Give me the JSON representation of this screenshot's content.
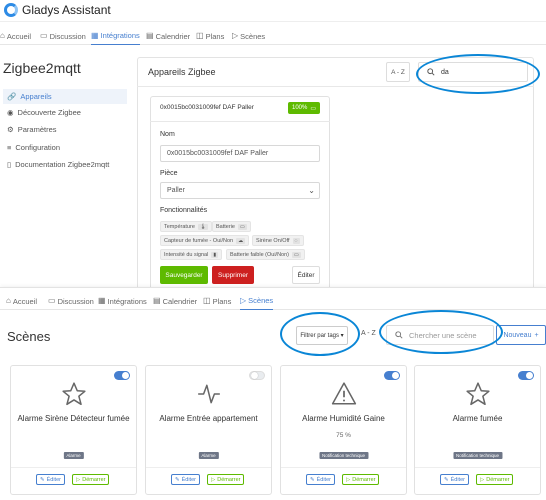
{
  "app": {
    "title": "Gladys Assistant"
  },
  "nav": [
    {
      "label": "Accueil",
      "icon": "home-icon",
      "glyph": "⌂"
    },
    {
      "label": "Discussion",
      "icon": "chat-icon",
      "glyph": "▭"
    },
    {
      "label": "Intégrations",
      "icon": "grid-icon",
      "glyph": "▦"
    },
    {
      "label": "Calendrier",
      "icon": "calendar-icon",
      "glyph": "▤"
    },
    {
      "label": "Plans",
      "icon": "map-icon",
      "glyph": "◫"
    },
    {
      "label": "Scènes",
      "icon": "play-icon",
      "glyph": "▷"
    }
  ],
  "zigbee": {
    "page_title": "Zigbee2mqtt",
    "sidebar": [
      {
        "label": "Appareils",
        "icon": "link-icon",
        "glyph": "🔗"
      },
      {
        "label": "Découverte Zigbee",
        "icon": "wifi-icon",
        "glyph": "◉"
      },
      {
        "label": "Paramètres",
        "icon": "gear-icon",
        "glyph": "⚙"
      },
      {
        "label": "Configuration",
        "icon": "sliders-icon",
        "glyph": "≡"
      },
      {
        "label": "Documentation Zigbee2mqtt",
        "icon": "book-icon",
        "glyph": "▯"
      }
    ],
    "panel_title": "Appareils Zigbee",
    "sort_label": "A - Z",
    "search_value": "da",
    "device": {
      "name": "0x0015bc0031009fef DAF Paller",
      "battery": "100%",
      "name_label": "Nom",
      "name_value": "0x0015bc0031009fef DAF Paller",
      "room_label": "Pièce",
      "room_value": "Paller",
      "features_label": "Fonctionnalités",
      "features": [
        {
          "label": "Température",
          "icon": "🌡"
        },
        {
          "label": "Batterie",
          "icon": "▭"
        },
        {
          "label": "Capteur de fumée - Oui/Non",
          "icon": "☁"
        },
        {
          "label": "Sirène On/Off",
          "icon": "◌"
        },
        {
          "label": "Intensité du signal",
          "icon": "▮"
        },
        {
          "label": "Batterie faible (Oui/Non)",
          "icon": "▭"
        }
      ],
      "save_label": "Sauvegarder",
      "delete_label": "Supprimer",
      "edit_label": "Éditer"
    }
  },
  "scenes": {
    "title": "Scènes",
    "filter_label": "Filtrer par tags",
    "sort_label": "A - Z",
    "search_placeholder": "Chercher une scène",
    "new_label": "Nouveau",
    "edit_label": "Éditer",
    "start_label": "Démarrer",
    "cards": [
      {
        "name": "Alarme Sirène Détecteur fumée",
        "subtitle": "",
        "tag": "Alarme",
        "icon": "star-icon",
        "enabled": true
      },
      {
        "name": "Alarme Entrée appartement",
        "subtitle": "",
        "tag": "Alarme",
        "icon": "activity-icon",
        "enabled": false
      },
      {
        "name": "Alarme Humidité Gaine",
        "subtitle": "75 %",
        "tag": "Notification technique",
        "icon": "warning-icon",
        "enabled": true
      },
      {
        "name": "Alarme fumée",
        "subtitle": "",
        "tag": "Notification technique",
        "icon": "star-icon",
        "enabled": true
      }
    ]
  },
  "colors": {
    "accent": "#467fcf",
    "success": "#5eba00",
    "danger": "#cd201f",
    "annotation": "#0a86d6"
  }
}
